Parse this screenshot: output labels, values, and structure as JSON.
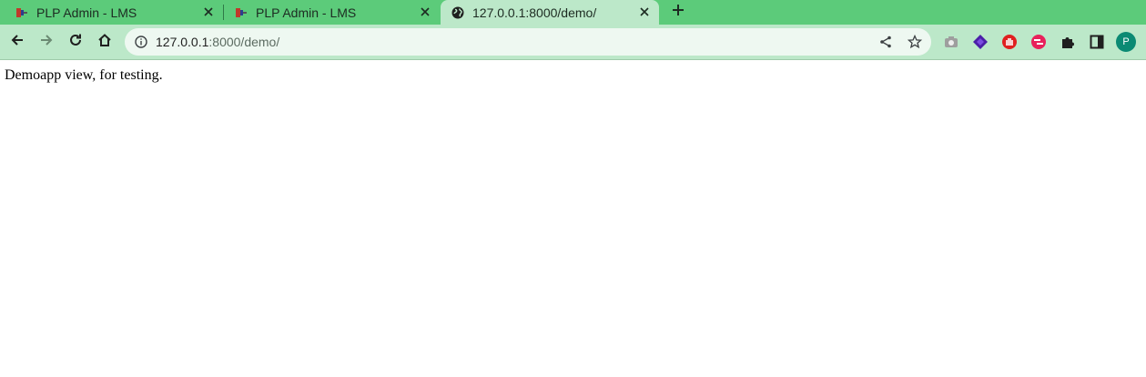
{
  "browser": {
    "tabs": [
      {
        "title": "PLP Admin - LMS",
        "active": false
      },
      {
        "title": "PLP Admin - LMS",
        "active": false
      },
      {
        "title": "127.0.0.1:8000/demo/",
        "active": true
      }
    ],
    "address_bar": {
      "host": "127.0.0.1",
      "path": ":8000/demo/"
    },
    "profile_initial": "P"
  },
  "colors": {
    "tab_strip": "#5ccb7a",
    "toolbar": "#bce8c9",
    "omnibox": "#eef8f1",
    "avatar": "#0b8a73"
  },
  "page": {
    "text": "Demoapp view, for testing."
  }
}
